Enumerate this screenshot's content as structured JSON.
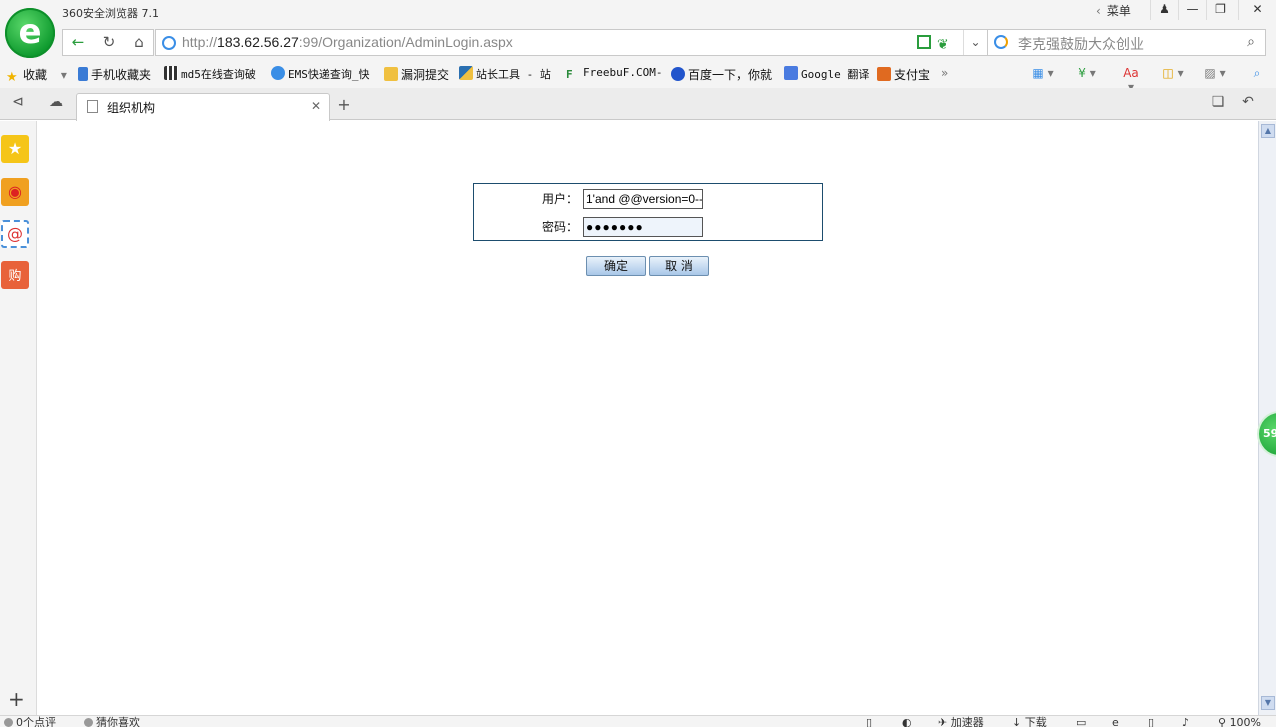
{
  "window": {
    "title": "360安全浏览器 7.1",
    "menu_label": "菜单"
  },
  "address": {
    "url_scheme": "http://",
    "url_host": "183.62.56.27",
    "url_rest": ":99/Organization/AdminLogin.aspx"
  },
  "search": {
    "placeholder": "李克强鼓励大众创业"
  },
  "bookmarks": [
    {
      "label": "收藏",
      "color": "#f0b400"
    },
    {
      "label": "手机收藏夹",
      "color": "#3a7bd5"
    },
    {
      "label": "md5在线查询破",
      "color": "#333333"
    },
    {
      "label": "EMS快递查询_快",
      "color": "#3a8ee6"
    },
    {
      "label": "漏洞提交",
      "color": "#f0c040"
    },
    {
      "label": "站长工具 - 站",
      "color": "#2a6fb0"
    },
    {
      "label": "FreebuF.COM-",
      "color": "#2a8a3a"
    },
    {
      "label": "百度一下，你就",
      "color": "#2255cc"
    },
    {
      "label": "Google 翻译",
      "color": "#4a7be0"
    },
    {
      "label": "支付宝",
      "color": "#e06a20"
    }
  ],
  "tab": {
    "title": "组织机构"
  },
  "form": {
    "user_label": "用户：",
    "user_value": "1'and @@version=0--",
    "password_label": "密码：",
    "password_value": "●●●●●●●",
    "confirm_label": "确定",
    "cancel_label": "取 消"
  },
  "speed_badge": "59",
  "status": {
    "comments": "0个点评",
    "guess": "猜你喜欢",
    "accelerator": "加速器",
    "download": "下载",
    "zoom": "100%"
  }
}
